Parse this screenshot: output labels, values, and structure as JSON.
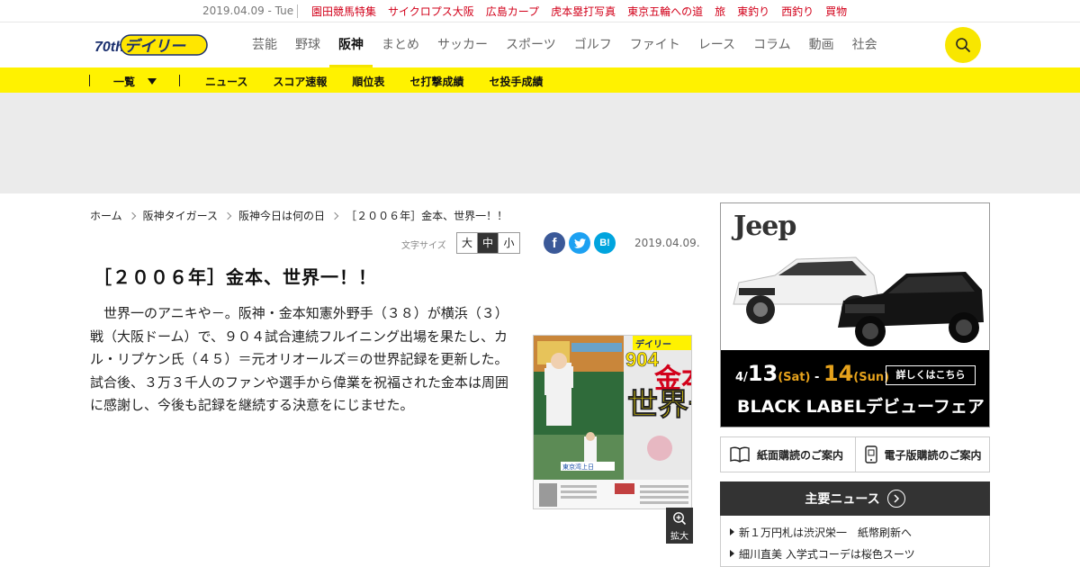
{
  "topbar": {
    "date": "2019.04.09 - Tue",
    "links": [
      "園田競馬特集",
      "サイクロプス大阪",
      "広島カープ",
      "虎本塁打写真",
      "東京五輪への道",
      "旅",
      "東釣り",
      "西釣り",
      "買物"
    ]
  },
  "header": {
    "logo_text": "デイリー",
    "logo_badge": "70th",
    "nav": [
      "芸能",
      "野球",
      "阪神",
      "まとめ",
      "サッカー",
      "スポーツ",
      "ゴルフ",
      "ファイト",
      "レース",
      "コラム",
      "動画",
      "社会"
    ],
    "active_nav": "阪神"
  },
  "subnav": {
    "all_label": "一覧",
    "links": [
      "ニュース",
      "スコア速報",
      "順位表",
      "セ打撃成績",
      "セ投手成績"
    ]
  },
  "breadcrumb": [
    "ホーム",
    "阪神タイガース",
    "阪神今日は何の日",
    "［２００６年］金本、世界一！！"
  ],
  "tools": {
    "font_size_label": "文字サイズ",
    "font_sizes": [
      "大",
      "中",
      "小"
    ],
    "selected_font_size": "中",
    "share_fb": "f",
    "share_hatena": "B!",
    "date": "2019.04.09."
  },
  "article": {
    "title": "［２００６年］金本、世界一！！",
    "body": "世界一のアニキや－。阪神・金本知憲外野手（３８）が横浜（３）戦（大阪ドーム）で、９０４試合連続フルイニング出場を果たし、カル・リプケン氏（４５）＝元オリオールズ＝の世界記録を更新した。試合後、３万３千人のファンや選手から偉業を祝福された金本は周囲に感謝し、今後も記録を継続する決意をにじませた。",
    "zoom_label": "拡大",
    "paper": {
      "masthead": "デイリー",
      "big_number": "904",
      "headline_1": "金本",
      "headline_2": "世界一",
      "sub_caption": "東京湾上日"
    }
  },
  "sidebar": {
    "ad": {
      "brand": "Jeep",
      "date_pre": "4/",
      "date_day1": "13",
      "date_dow1": "(Sat)",
      "date_dash": " - ",
      "date_day2": "14",
      "date_dow2": "(Sun)",
      "detail_label": "詳しくはこちら",
      "fair_label": "BLACK LABELデビューフェア"
    },
    "subscribe_paper": "紙面購読のご案内",
    "subscribe_digital": "電子版購読のご案内",
    "main_news_title": "主要ニュース",
    "main_news": [
      "新１万円札は渋沢栄一　紙幣刷新へ",
      "細川直美 入学式コーデは桜色スーツ"
    ]
  },
  "colors": {
    "brand_yellow": "#fff200",
    "accent_red": "#d2001a",
    "facebook": "#3b5998",
    "twitter": "#1da1f2",
    "hatena": "#00a4de"
  }
}
